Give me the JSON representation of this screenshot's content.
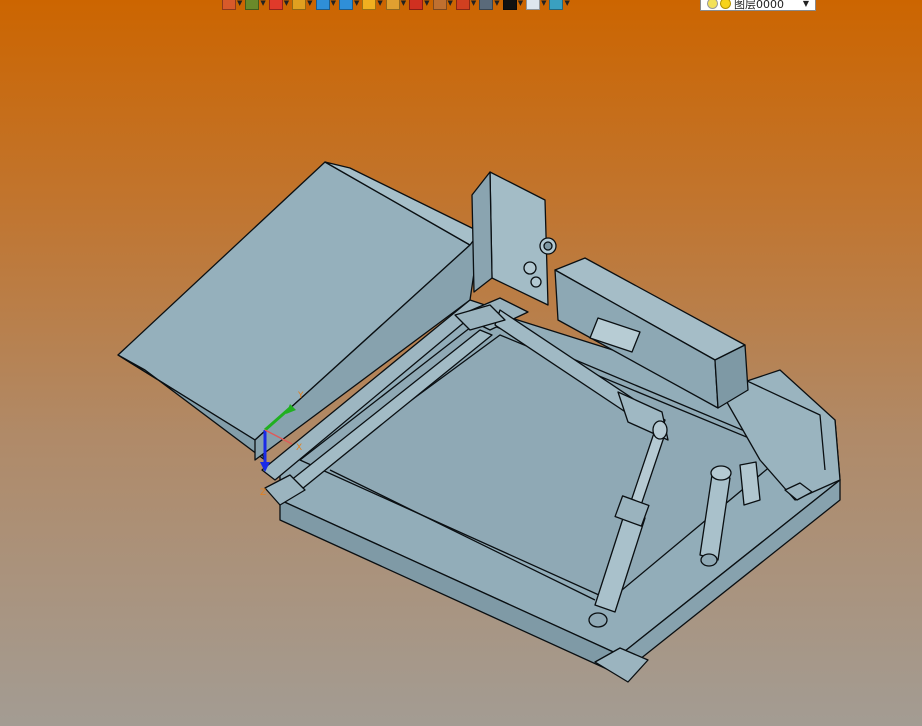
{
  "toolbar": {
    "buttons": [
      {
        "name": "view-icon",
        "color": "#d85a2a"
      },
      {
        "name": "trim-icon",
        "color": "#6a8a2a"
      },
      {
        "name": "sketch-icon",
        "color": "#e03a2a"
      },
      {
        "name": "box-icon",
        "color": "#e0a020"
      },
      {
        "name": "solid-blue-icon",
        "color": "#2f8fd8"
      },
      {
        "name": "solid-cube-icon",
        "color": "#2f8fd8"
      },
      {
        "name": "sphere-icon",
        "color": "#f0b020"
      },
      {
        "name": "render-icon",
        "color": "#e0a030"
      },
      {
        "name": "move-icon",
        "color": "#d03020"
      },
      {
        "name": "copy-icon",
        "color": "#c07030"
      },
      {
        "name": "clipboard-icon",
        "color": "#d04020"
      },
      {
        "name": "display-icon",
        "color": "#5a6a7a"
      },
      {
        "name": "color-black-icon",
        "color": "#111111"
      },
      {
        "name": "page-icon",
        "color": "#dde6ee"
      },
      {
        "name": "layers-icon",
        "color": "#3aa0c0"
      }
    ],
    "layer_select": {
      "value": "图层0000"
    }
  },
  "scene": {
    "model_fill": "#93aeba",
    "model_stroke": "#0a0f12",
    "axis": {
      "x_label": "X",
      "y_label": "Y",
      "z_label": "Z"
    }
  }
}
